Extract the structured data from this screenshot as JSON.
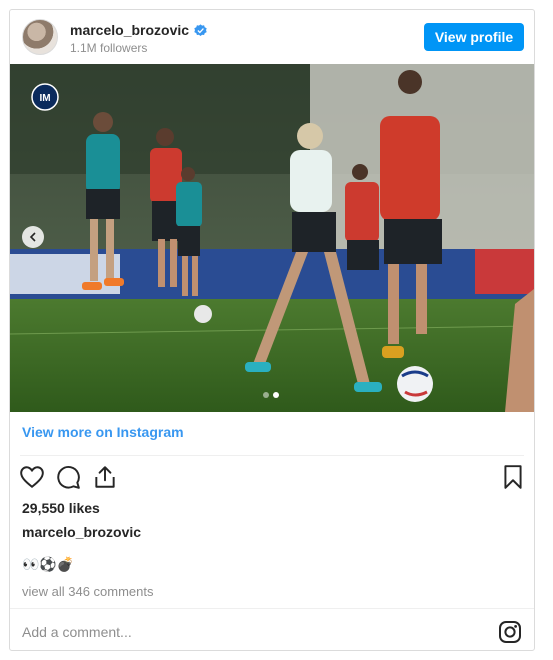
{
  "header": {
    "username": "marcelo_brozovic",
    "verified": true,
    "followers": "1.1M followers",
    "view_profile_label": "View profile"
  },
  "post": {
    "image_count": 2,
    "active_image_index": 1,
    "view_more_label": "View more on Instagram",
    "likes": "29,550 likes",
    "caption_user": "marcelo_brozovic",
    "caption_text": "👀⚽💣",
    "comments_link": "view all 346 comments"
  },
  "comment": {
    "placeholder": "Add a comment..."
  },
  "colors": {
    "accent": "#0095f6",
    "link": "#3897f0",
    "verified": "#3897f0",
    "border": "#dbdbdb",
    "muted": "#8e8e8e"
  },
  "icons": [
    "verified-badge-icon",
    "chevron-left-icon",
    "heart-icon",
    "comment-icon",
    "share-icon",
    "bookmark-icon",
    "instagram-icon"
  ]
}
